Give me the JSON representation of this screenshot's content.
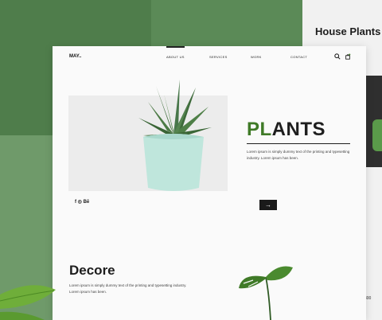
{
  "right_panel": {
    "title": "House Plants",
    "page_number": "300"
  },
  "nav": {
    "logo": "MAY..",
    "items": [
      "ABOUT US",
      "SERVICES",
      "WORK",
      "CONTACT"
    ]
  },
  "hero": {
    "title_accent": "PL",
    "title_rest": "ANTS",
    "description": "Lorem ipsum is simply dummy text of the printing and typesetting industry. Lorem ipsum has been.",
    "social": "f ◎ Bē",
    "arrow": "→"
  },
  "decore": {
    "title": "Decore",
    "description": "Lorem ipsum is simply dummy text of the printing and typesetting industry. Lorem ipsum has been."
  },
  "colors": {
    "accent_green": "#3f7a27",
    "background_green": "#5b8a57",
    "pot": "#bfe6dc"
  }
}
